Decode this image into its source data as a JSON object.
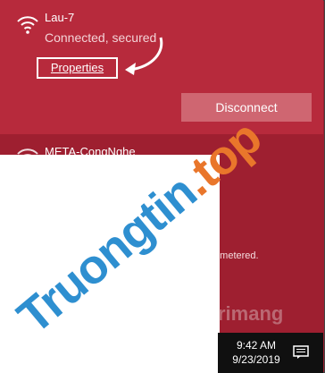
{
  "network": {
    "name": "Lau-7",
    "status": "Connected, secured",
    "properties_label": "Properties",
    "disconnect_label": "Disconnect"
  },
  "second_network": {
    "name": "META-CongNghe",
    "metered_text": "n metered."
  },
  "watermark": {
    "main": "Truongtin",
    "dot": ".",
    "suffix": "top",
    "brand": "rimang"
  },
  "taskbar": {
    "time": "9:42 AM",
    "date": "9/23/2019"
  },
  "colors": {
    "active_panel": "#b72a3c",
    "background": "#9e1f30",
    "button": "#cf6671"
  },
  "icons": {
    "wifi": "wifi-icon",
    "arrow": "curved-arrow-icon",
    "notifications": "action-center-icon"
  }
}
